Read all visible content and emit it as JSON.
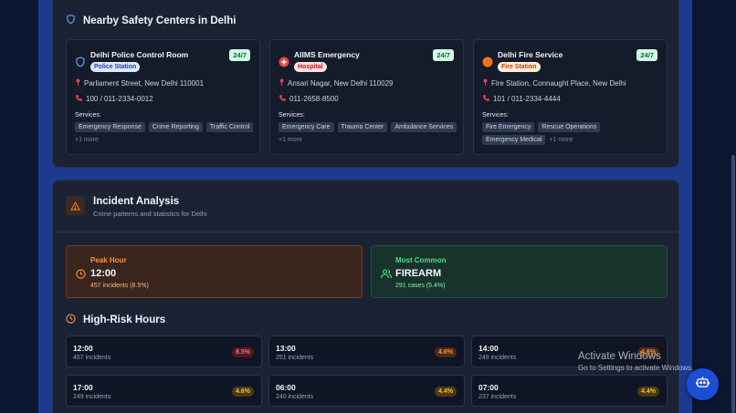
{
  "safety": {
    "title": "Nearby Safety Centers in Delhi",
    "services_label": "Services:",
    "centers": [
      {
        "name": "Delhi Police Control Room",
        "type": "Police Station",
        "availability": "24/7",
        "address": "Parliament Street, New Delhi 110001",
        "phone": "100 / 011-2334-0012",
        "services": [
          "Emergency Response",
          "Crime Reporting",
          "Traffic Control"
        ],
        "more": "+1 more",
        "icon": "shield-icon"
      },
      {
        "name": "AIIMS Emergency",
        "type": "Hospital",
        "availability": "24/7",
        "address": "Ansari Nagar, New Delhi 110029",
        "phone": "011-2658-8500",
        "services": [
          "Emergency Care",
          "Trauma Center",
          "Ambulance Services"
        ],
        "more": "+1 more",
        "icon": "hospital-cross-icon"
      },
      {
        "name": "Delhi Fire Service",
        "type": "Fire Station",
        "availability": "24/7",
        "address": "Fire Station, Connaught Place, New Delhi",
        "phone": "101 / 011-2334-4444",
        "services": [
          "Fire Emergency",
          "Rescue Operations",
          "Emergency Medical"
        ],
        "more": "+1 more",
        "icon": "fire-icon"
      }
    ]
  },
  "incident": {
    "title": "Incident Analysis",
    "subtitle": "Crime patterns and statistics for Delhi",
    "peak": {
      "label": "Peak Hour",
      "value": "12:00",
      "detail": "457 incidents (8.5%)"
    },
    "common": {
      "label": "Most Common",
      "value": "FIREARM",
      "detail": "291 cases (5.4%)"
    },
    "high_risk_title": "High-Risk Hours",
    "hours": [
      {
        "time": "12:00",
        "count": "457 incidents",
        "pct": "8.5%",
        "level": "high"
      },
      {
        "time": "13:00",
        "count": "251 incidents",
        "pct": "4.6%",
        "level": "mid"
      },
      {
        "time": "14:00",
        "count": "249 incidents",
        "pct": "4.6%",
        "level": "mid"
      },
      {
        "time": "17:00",
        "count": "249 incidents",
        "pct": "4.6%",
        "level": "mid"
      },
      {
        "time": "06:00",
        "count": "240 incidents",
        "pct": "4.4%",
        "level": "mid"
      },
      {
        "time": "07:00",
        "count": "237 incidents",
        "pct": "4.4%",
        "level": "mid"
      }
    ]
  },
  "watermark": {
    "line1": "Activate Windows",
    "line2": "Go to Settings to activate Windows."
  },
  "colors": {
    "police_badge_bg": "#dbeafe",
    "police_badge_fg": "#1e40af",
    "hospital_badge_bg": "#fee2e2",
    "hospital_badge_fg": "#b91c1c",
    "fire_badge_bg": "#ffedd5",
    "fire_badge_fg": "#c2410c",
    "peak_accent": "#fb923c",
    "common_accent": "#4ade80"
  }
}
